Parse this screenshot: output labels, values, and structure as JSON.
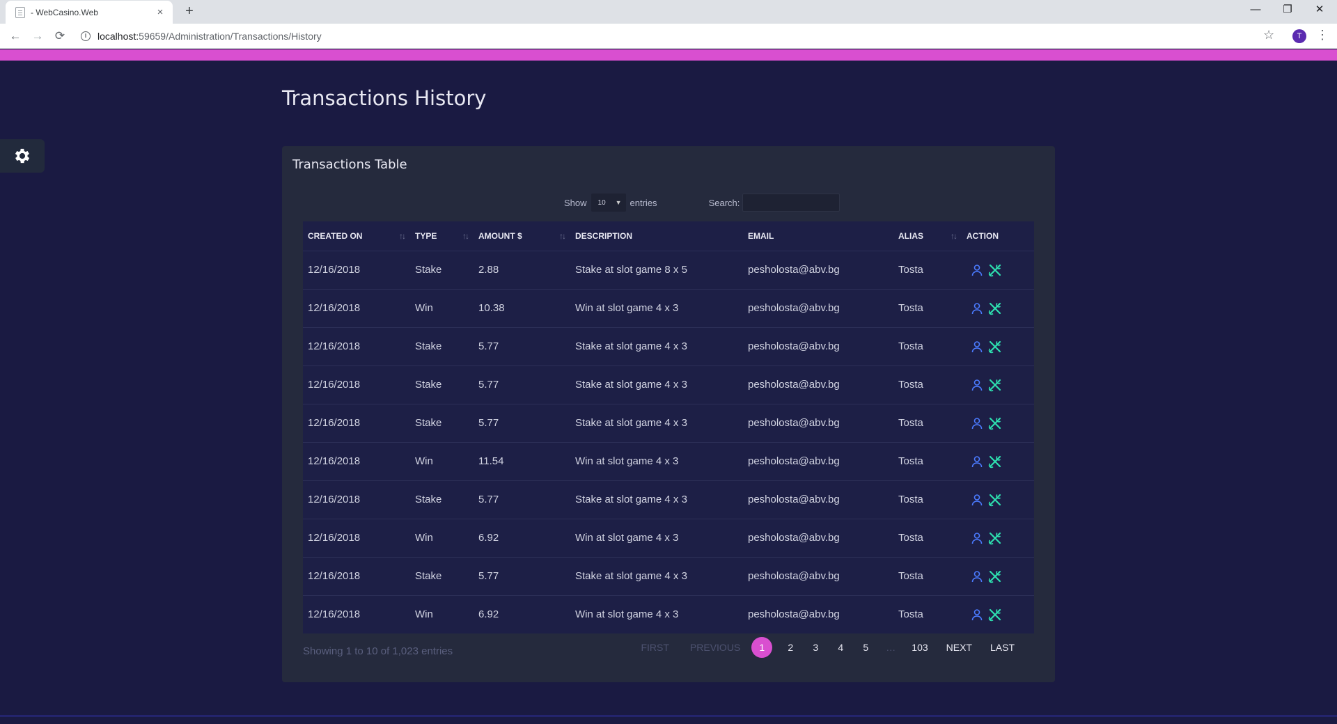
{
  "browser": {
    "tab_title": "- WebCasino.Web",
    "close_glyph": "×",
    "new_tab_glyph": "+",
    "url_host": "localhost:",
    "url_path": "59659/Administration/Transactions/History",
    "info_glyph": "i",
    "avatar_letter": "T",
    "back_glyph": "←",
    "forward_glyph": "→",
    "reload_glyph": "⟳",
    "star_glyph": "☆",
    "menu_glyph": "⋮",
    "minimize_glyph": "—",
    "restore_glyph": "❐",
    "close_window_glyph": "✕"
  },
  "colors": {
    "page_bg": "#1a1a42",
    "accent": "#d94fd0",
    "card_bg": "#252a3d",
    "table_bg": "#1d1f46",
    "user_icon": "#4b7bff",
    "edit_icon": "#2ee0b0"
  },
  "icons": {
    "settings": "gear-icon",
    "user": "user-icon",
    "edit": "tools-icon"
  },
  "page": {
    "title": "Transactions History"
  },
  "card": {
    "title": "Transactions Table",
    "show_label": "Show",
    "entries_label": "entries",
    "page_length": "10",
    "search_label": "Search:",
    "search_value": ""
  },
  "table": {
    "columns": [
      "Created On",
      "Type",
      "Amount $",
      "Description",
      "Email",
      "Alias",
      "Action"
    ],
    "sort_glyph": "↑↓",
    "rows": [
      {
        "created_on": "12/16/2018",
        "type": "Stake",
        "amount": "2.88",
        "description": "Stake at slot game 8 x 5",
        "email": "pesholosta@abv.bg",
        "alias": "Tosta"
      },
      {
        "created_on": "12/16/2018",
        "type": "Win",
        "amount": "10.38",
        "description": "Win at slot game 4 x 3",
        "email": "pesholosta@abv.bg",
        "alias": "Tosta"
      },
      {
        "created_on": "12/16/2018",
        "type": "Stake",
        "amount": "5.77",
        "description": "Stake at slot game 4 x 3",
        "email": "pesholosta@abv.bg",
        "alias": "Tosta"
      },
      {
        "created_on": "12/16/2018",
        "type": "Stake",
        "amount": "5.77",
        "description": "Stake at slot game 4 x 3",
        "email": "pesholosta@abv.bg",
        "alias": "Tosta"
      },
      {
        "created_on": "12/16/2018",
        "type": "Stake",
        "amount": "5.77",
        "description": "Stake at slot game 4 x 3",
        "email": "pesholosta@abv.bg",
        "alias": "Tosta"
      },
      {
        "created_on": "12/16/2018",
        "type": "Win",
        "amount": "11.54",
        "description": "Win at slot game 4 x 3",
        "email": "pesholosta@abv.bg",
        "alias": "Tosta"
      },
      {
        "created_on": "12/16/2018",
        "type": "Stake",
        "amount": "5.77",
        "description": "Stake at slot game 4 x 3",
        "email": "pesholosta@abv.bg",
        "alias": "Tosta"
      },
      {
        "created_on": "12/16/2018",
        "type": "Win",
        "amount": "6.92",
        "description": "Win at slot game 4 x 3",
        "email": "pesholosta@abv.bg",
        "alias": "Tosta"
      },
      {
        "created_on": "12/16/2018",
        "type": "Stake",
        "amount": "5.77",
        "description": "Stake at slot game 4 x 3",
        "email": "pesholosta@abv.bg",
        "alias": "Tosta"
      },
      {
        "created_on": "12/16/2018",
        "type": "Win",
        "amount": "6.92",
        "description": "Win at slot game 4 x 3",
        "email": "pesholosta@abv.bg",
        "alias": "Tosta"
      }
    ]
  },
  "footer": {
    "info": "Showing 1 to 10 of 1,023 entries"
  },
  "pagination": {
    "first": "FIRST",
    "previous": "PREVIOUS",
    "pages": [
      "1",
      "2",
      "3",
      "4",
      "5"
    ],
    "ellipsis": "…",
    "last_page": "103",
    "next": "NEXT",
    "last": "LAST",
    "current": "1"
  }
}
